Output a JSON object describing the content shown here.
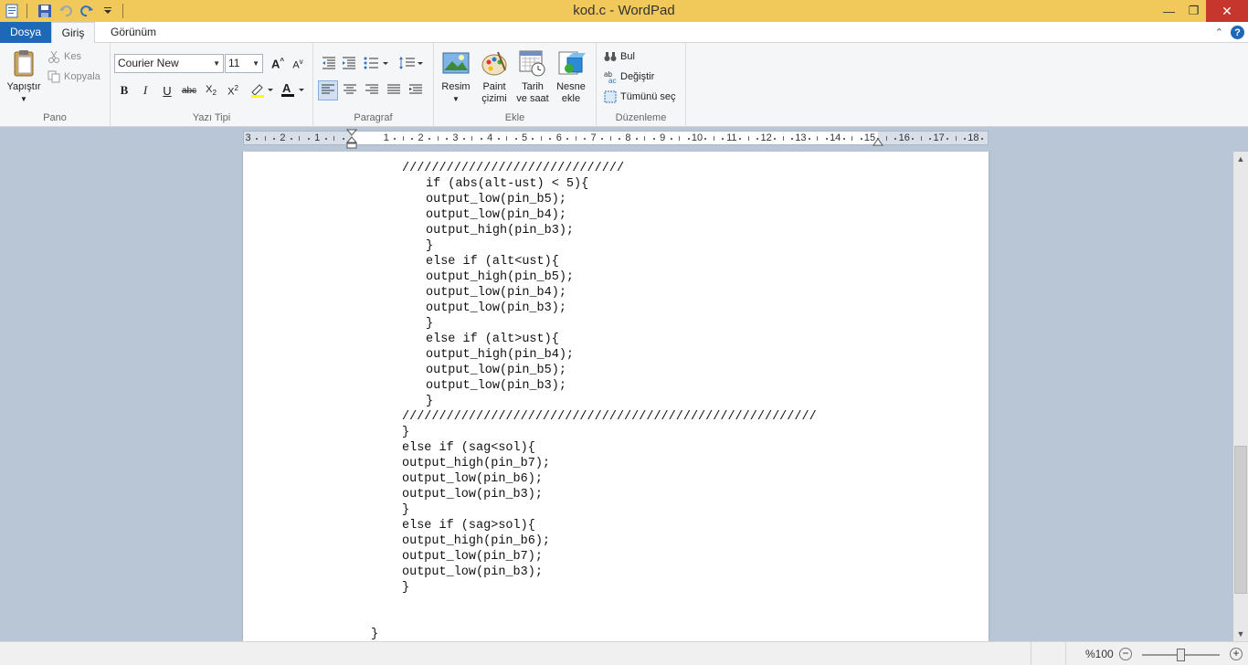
{
  "window": {
    "title": "kod.c - WordPad"
  },
  "tabs": {
    "file": "Dosya",
    "home": "Giriş",
    "view": "Görünüm"
  },
  "clipboard": {
    "paste": "Yapıştır",
    "cut": "Kes",
    "copy": "Kopyala",
    "group": "Pano"
  },
  "font": {
    "family": "Courier New",
    "size": "11",
    "group": "Yazı Tipi"
  },
  "paragraph": {
    "group": "Paragraf"
  },
  "insert": {
    "picture": "Resim",
    "paint_1": "Paint",
    "paint_2": "çizimi",
    "datetime_1": "Tarih",
    "datetime_2": "ve saat",
    "object_1": "Nesne",
    "object_2": "ekle",
    "group": "Ekle"
  },
  "editing": {
    "find": "Bul",
    "replace": "Değiştir",
    "selectall": "Tümünü seç",
    "group": "Düzenleme"
  },
  "ruler": {
    "labels": [
      "3",
      "2",
      "1",
      "1",
      "2",
      "3",
      "4",
      "5",
      "6",
      "7",
      "8",
      "9",
      "10",
      "11",
      "12",
      "13",
      "14",
      "15",
      "16",
      "17",
      "18"
    ]
  },
  "document": {
    "lines": [
      {
        "indent": 174,
        "text": "//////////////////////////////"
      },
      {
        "indent": 200,
        "text": "if (abs(alt-ust) < 5){"
      },
      {
        "indent": 200,
        "text": "output_low(pin_b5);"
      },
      {
        "indent": 200,
        "text": "output_low(pin_b4);"
      },
      {
        "indent": 200,
        "text": "output_high(pin_b3);"
      },
      {
        "indent": 200,
        "text": "}"
      },
      {
        "indent": 200,
        "text": "else if (alt<ust){"
      },
      {
        "indent": 200,
        "text": "output_high(pin_b5);"
      },
      {
        "indent": 200,
        "text": "output_low(pin_b4);"
      },
      {
        "indent": 200,
        "text": "output_low(pin_b3);"
      },
      {
        "indent": 200,
        "text": "}"
      },
      {
        "indent": 200,
        "text": "else if (alt>ust){"
      },
      {
        "indent": 200,
        "text": "output_high(pin_b4);"
      },
      {
        "indent": 200,
        "text": "output_low(pin_b5);"
      },
      {
        "indent": 200,
        "text": "output_low(pin_b3);"
      },
      {
        "indent": 200,
        "text": "}"
      },
      {
        "indent": 174,
        "text": "////////////////////////////////////////////////////////"
      },
      {
        "indent": 174,
        "text": "}"
      },
      {
        "indent": 174,
        "text": "else if (sag<sol){"
      },
      {
        "indent": 174,
        "text": "output_high(pin_b7);"
      },
      {
        "indent": 174,
        "text": "output_low(pin_b6);"
      },
      {
        "indent": 174,
        "text": "output_low(pin_b3);"
      },
      {
        "indent": 174,
        "text": "}"
      },
      {
        "indent": 174,
        "text": "else if (sag>sol){"
      },
      {
        "indent": 174,
        "text": "output_high(pin_b6);"
      },
      {
        "indent": 174,
        "text": "output_low(pin_b7);"
      },
      {
        "indent": 174,
        "text": "output_low(pin_b3);"
      },
      {
        "indent": 174,
        "text": "}"
      },
      {
        "indent": 174,
        "text": ""
      },
      {
        "indent": 174,
        "text": ""
      },
      {
        "indent": 140,
        "text": "}"
      }
    ]
  },
  "status": {
    "zoom": "%100",
    "zoom_level": 0.5
  }
}
